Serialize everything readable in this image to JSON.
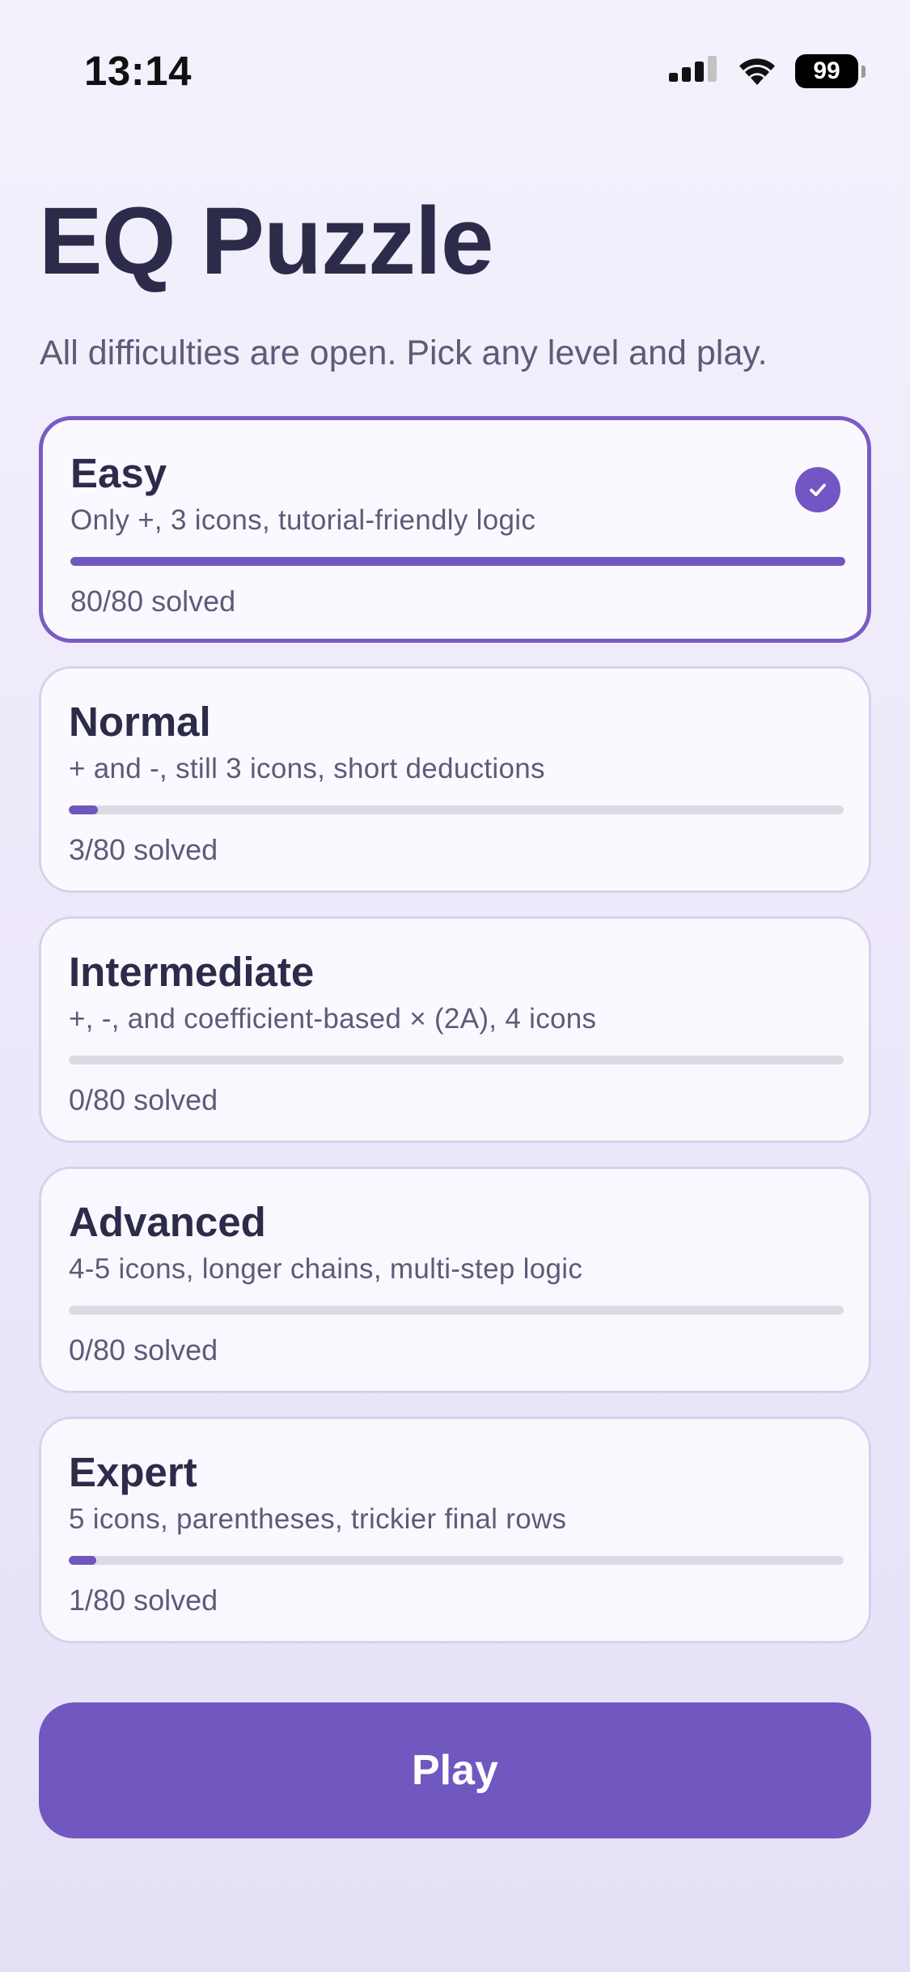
{
  "status_bar": {
    "time": "13:14",
    "battery": "99",
    "icons": [
      "signal-icon",
      "wifi-icon",
      "battery-icon"
    ]
  },
  "header": {
    "title": "EQ Puzzle",
    "subtitle": "All difficulties are open. Pick any level and play."
  },
  "levels": [
    {
      "name": "Easy",
      "description": "Only +, 3 icons, tutorial-friendly logic",
      "solved": 80,
      "total": 80,
      "solved_label": "80/80 solved",
      "selected": true
    },
    {
      "name": "Normal",
      "description": "+ and -, still 3 icons, short deductions",
      "solved": 3,
      "total": 80,
      "solved_label": "3/80 solved",
      "selected": false
    },
    {
      "name": "Intermediate",
      "description": "+, -, and coefficient-based × (2A), 4 icons",
      "solved": 0,
      "total": 80,
      "solved_label": "0/80 solved",
      "selected": false
    },
    {
      "name": "Advanced",
      "description": "4-5 icons, longer chains, multi-step logic",
      "solved": 0,
      "total": 80,
      "solved_label": "0/80 solved",
      "selected": false
    },
    {
      "name": "Expert",
      "description": "5 icons, parentheses, trickier final rows",
      "solved": 1,
      "total": 80,
      "solved_label": "1/80 solved",
      "selected": false
    }
  ],
  "play_button": {
    "label": "Play"
  },
  "colors": {
    "accent": "#7157c0",
    "text_primary": "#2c2c4a",
    "text_secondary": "#5d5b78",
    "track": "#dcdae3"
  }
}
